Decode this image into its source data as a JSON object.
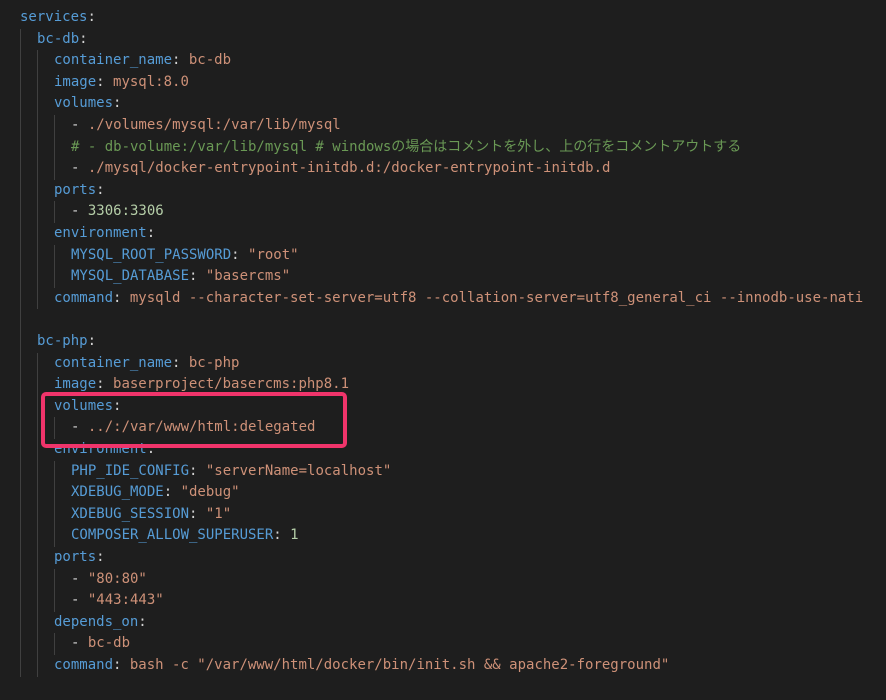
{
  "colors": {
    "background": "#1e1e1e",
    "key": "#569cd6",
    "punctuation": "#d4d4d4",
    "string": "#ce9178",
    "number": "#b5cea8",
    "comment": "#6a9955",
    "guide": "#404040",
    "highlight_border": "#f0346b"
  },
  "lines": [
    [
      [
        "k",
        "services"
      ],
      [
        "p",
        ":"
      ]
    ],
    [
      [
        "k",
        "bc-db"
      ],
      [
        "p",
        ":"
      ]
    ],
    [
      [
        "k",
        "container_name"
      ],
      [
        "p",
        ": "
      ],
      [
        "s",
        "bc-db"
      ]
    ],
    [
      [
        "k",
        "image"
      ],
      [
        "p",
        ": "
      ],
      [
        "s",
        "mysql:8.0"
      ]
    ],
    [
      [
        "k",
        "volumes"
      ],
      [
        "p",
        ":"
      ]
    ],
    [
      [
        "p",
        "- "
      ],
      [
        "s",
        "./volumes/mysql:/var/lib/mysql"
      ]
    ],
    [
      [
        "c",
        "# - db-volume:/var/lib/mysql # windowsの場合はコメントを外し、上の行をコメントアウトする"
      ]
    ],
    [
      [
        "p",
        "- "
      ],
      [
        "s",
        "./mysql/docker-entrypoint-initdb.d:/docker-entrypoint-initdb.d"
      ]
    ],
    [
      [
        "k",
        "ports"
      ],
      [
        "p",
        ":"
      ]
    ],
    [
      [
        "p",
        "- "
      ],
      [
        "n",
        "3306:3306"
      ]
    ],
    [
      [
        "k",
        "environment"
      ],
      [
        "p",
        ":"
      ]
    ],
    [
      [
        "k",
        "MYSQL_ROOT_PASSWORD"
      ],
      [
        "p",
        ": "
      ],
      [
        "s",
        "\"root\""
      ]
    ],
    [
      [
        "k",
        "MYSQL_DATABASE"
      ],
      [
        "p",
        ": "
      ],
      [
        "s",
        "\"basercms\""
      ]
    ],
    [
      [
        "k",
        "command"
      ],
      [
        "p",
        ": "
      ],
      [
        "s",
        "mysqld --character-set-server=utf8 --collation-server=utf8_general_ci --innodb-use-nati"
      ]
    ],
    [],
    [
      [
        "k",
        "bc-php"
      ],
      [
        "p",
        ":"
      ]
    ],
    [
      [
        "k",
        "container_name"
      ],
      [
        "p",
        ": "
      ],
      [
        "s",
        "bc-php"
      ]
    ],
    [
      [
        "k",
        "image"
      ],
      [
        "p",
        ": "
      ],
      [
        "s",
        "baserproject/basercms:php8.1"
      ]
    ],
    [
      [
        "k",
        "volumes"
      ],
      [
        "p",
        ":"
      ]
    ],
    [
      [
        "p",
        "- "
      ],
      [
        "s",
        "../:/var/www/html:delegated"
      ]
    ],
    [
      [
        "k",
        "environment"
      ],
      [
        "p",
        ":"
      ]
    ],
    [
      [
        "k",
        "PHP_IDE_CONFIG"
      ],
      [
        "p",
        ": "
      ],
      [
        "s",
        "\"serverName=localhost\""
      ]
    ],
    [
      [
        "k",
        "XDEBUG_MODE"
      ],
      [
        "p",
        ": "
      ],
      [
        "s",
        "\"debug\""
      ]
    ],
    [
      [
        "k",
        "XDEBUG_SESSION"
      ],
      [
        "p",
        ": "
      ],
      [
        "s",
        "\"1\""
      ]
    ],
    [
      [
        "k",
        "COMPOSER_ALLOW_SUPERUSER"
      ],
      [
        "p",
        ": "
      ],
      [
        "n",
        "1"
      ]
    ],
    [
      [
        "k",
        "ports"
      ],
      [
        "p",
        ":"
      ]
    ],
    [
      [
        "p",
        "- "
      ],
      [
        "s",
        "\"80:80\""
      ]
    ],
    [
      [
        "p",
        "- "
      ],
      [
        "s",
        "\"443:443\""
      ]
    ],
    [
      [
        "k",
        "depends_on"
      ],
      [
        "p",
        ":"
      ]
    ],
    [
      [
        "p",
        "- "
      ],
      [
        "s",
        "bc-db"
      ]
    ],
    [
      [
        "k",
        "command"
      ],
      [
        "p",
        ": "
      ],
      [
        "s",
        "bash -c \"/var/www/html/docker/bin/init.sh && apache2-foreground\""
      ]
    ],
    [],
    []
  ]
}
